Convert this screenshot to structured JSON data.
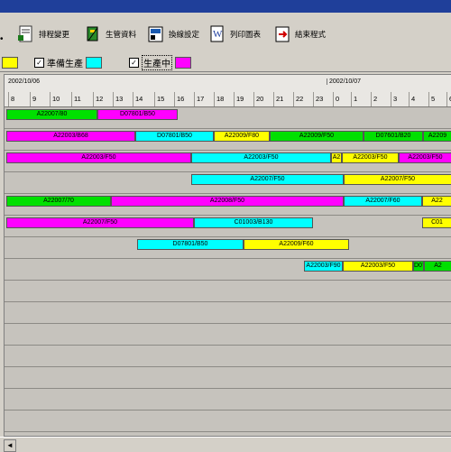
{
  "toolbar": {
    "buttons": [
      {
        "label": "排程變更",
        "icon": "schedule-change-icon"
      },
      {
        "label": "生管資料",
        "icon": "production-data-icon"
      },
      {
        "label": "換線設定",
        "icon": "changeover-settings-icon"
      },
      {
        "label": "列印圖表",
        "icon": "print-chart-icon"
      },
      {
        "label": "結束程式",
        "icon": "exit-program-icon"
      }
    ]
  },
  "legend": {
    "items": [
      {
        "label": "",
        "color": "#ffff00",
        "checked": false
      },
      {
        "label": "準備生產",
        "color": "#00ffff",
        "checked": true
      },
      {
        "label": "生產中",
        "color": "#ff00ff",
        "checked": true
      }
    ]
  },
  "timeline": {
    "dates": [
      "2002/10/06",
      "2002/10/07"
    ],
    "hours": [
      "8",
      "9",
      "10",
      "11",
      "12",
      "13",
      "14",
      "15",
      "16",
      "17",
      "18",
      "19",
      "20",
      "21",
      "22",
      "23",
      "0",
      "1",
      "2",
      "3",
      "4",
      "5",
      "6"
    ]
  },
  "colors": {
    "green": "#00e000",
    "magenta": "#ff00ff",
    "cyan": "#00ffff",
    "yellow": "#ffff00"
  },
  "rows": [
    [
      {
        "label": "A22007/80",
        "color": "#00e000"
      },
      {
        "label": "D07801/B50",
        "color": "#ff00ff"
      }
    ],
    [
      {
        "label": "A22003/B68",
        "color": "#ff00ff"
      },
      {
        "label": "D07801/B50",
        "color": "#00ffff"
      },
      {
        "label": "A22009/F80",
        "color": "#ffff00"
      },
      {
        "label": "A22009/F50",
        "color": "#00e000"
      },
      {
        "label": "D07601/B20",
        "color": "#00e000"
      },
      {
        "label": "A2209",
        "color": "#00e000"
      }
    ],
    [
      {
        "label": "A22003/F50",
        "color": "#ff00ff"
      },
      {
        "label": "A22003/F50",
        "color": "#00ffff"
      },
      {
        "label": "A2",
        "color": "#ffff00"
      },
      {
        "label": "A22003/F50",
        "color": "#ffff00"
      },
      {
        "label": "A22003/F50",
        "color": "#ff00ff"
      }
    ],
    [
      {
        "label": "A22007/F50",
        "color": "#00ffff"
      },
      {
        "label": "A22007/F50",
        "color": "#ffff00"
      }
    ],
    [
      {
        "label": "A22007/70",
        "color": "#00e000"
      },
      {
        "label": "A22008/F50",
        "color": "#ff00ff"
      },
      {
        "label": "A22007/F60",
        "color": "#00ffff"
      },
      {
        "label": "A22",
        "color": "#ffff00"
      }
    ],
    [
      {
        "label": "A22007/F50",
        "color": "#ff00ff"
      },
      {
        "label": "C01003/B130",
        "color": "#00ffff"
      },
      {
        "label": "C01",
        "color": "#ffff00"
      }
    ],
    [
      {
        "label": "D07801/B50",
        "color": "#00ffff"
      },
      {
        "label": "A22009/F60",
        "color": "#ffff00"
      }
    ],
    [
      {
        "label": "A22003/F90",
        "color": "#00ffff"
      },
      {
        "label": "A22003/F50",
        "color": "#ffff00"
      },
      {
        "label": "D07",
        "color": "#00e000"
      },
      {
        "label": "A2",
        "color": "#00e000"
      }
    ]
  ]
}
